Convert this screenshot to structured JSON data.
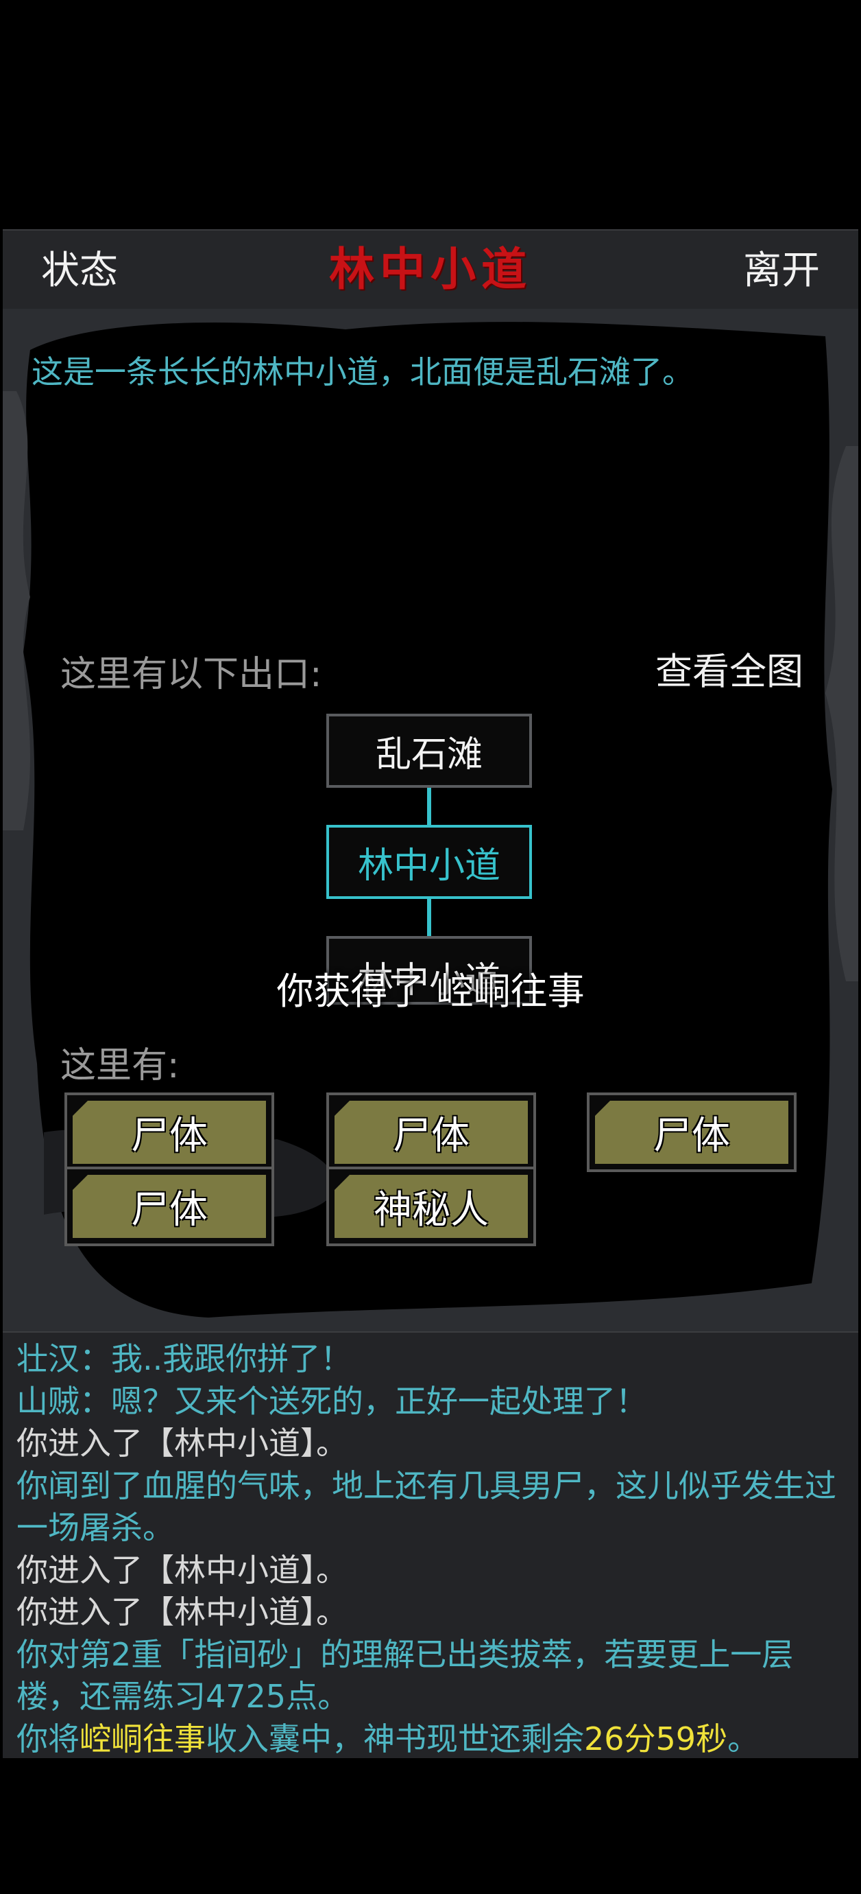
{
  "header": {
    "left_button": "状态",
    "title": "林中小道",
    "right_button": "离开"
  },
  "scene": {
    "description": "这是一条长长的林中小道，北面便是乱石滩了。",
    "exits_label": "这里有以下出口:",
    "map_button": "查看全图",
    "exits": {
      "north": "乱石滩",
      "current": "林中小道",
      "south": "林中小道"
    },
    "toast": "你获得了 崆峒往事",
    "here_label": "这里有:",
    "npcs": [
      "尸体",
      "尸体",
      "尸体",
      "尸体",
      "神秘人"
    ]
  },
  "log": {
    "line1": "壮汉：我..我跟你拼了！",
    "line2": "山贼：嗯？又来个送死的，正好一起处理了！",
    "line3": "你进入了【林中小道】。",
    "line4": "你闻到了血腥的气味，地上还有几具男尸，这儿似乎发生过一场屠杀。",
    "line5": "你进入了【林中小道】。",
    "line6": "你进入了【林中小道】。",
    "line7": "你对第2重「指间砂」的理解已出类拔萃，若要更上一层楼，还需练习4725点。",
    "line8_a": "你将",
    "line8_item": "崆峒往事",
    "line8_b": "收入囊中，神书现世还剩余",
    "line8_time": "26分59秒",
    "line8_c": "。"
  },
  "colors": {
    "accent_cyan": "#37c2cc",
    "title_red": "#c81216",
    "highlight_yellow": "#f0e23a",
    "npc_button": "#7c7a42"
  }
}
